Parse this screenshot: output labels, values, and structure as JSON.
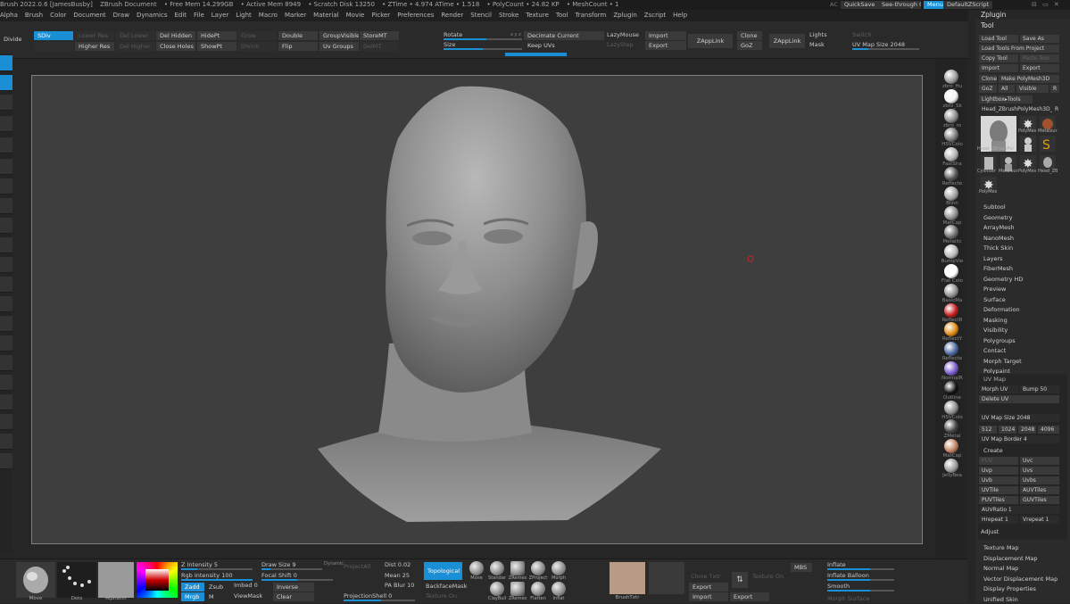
{
  "titlebar": {
    "app": "Brush 2022.0.6 [JamesBusby]",
    "doc": "ZBrush Document",
    "stats": [
      "• Free Mem 14.299GB",
      "• Active Mem 8949",
      "• Scratch Disk 13250",
      "• ZTime • 4.974 ATime • 1.518",
      "• PolyCount • 24.82 KP",
      "• MeshCount • 1"
    ],
    "ac": "AC",
    "quicksave": "QuickSave",
    "seethrough": "See-through  0",
    "menus": "Menus",
    "zscript": "DefaultZScript"
  },
  "menubar": [
    "Alpha",
    "Brush",
    "Color",
    "Document",
    "Draw",
    "Dynamics",
    "Edit",
    "File",
    "Layer",
    "Light",
    "Macro",
    "Marker",
    "Material",
    "Movie",
    "Picker",
    "Preferences",
    "Render",
    "Stencil",
    "Stroke",
    "Texture",
    "Tool",
    "Transform",
    "Zplugin",
    "Zscript",
    "Help"
  ],
  "topshelf": {
    "divide": "Divide",
    "smt": "SDiv",
    "lower_res": "Lower Res",
    "higher_res": "Higher Res",
    "del_lower": "Del Lower",
    "del_higher": "Del Higher",
    "del_hidden": "Del Hidden",
    "close_holes": "Close Holes",
    "hide_pt": "HidePt",
    "show_pt": "ShowPt",
    "grow": "Grow",
    "shrink": "Shrink",
    "double": "Double",
    "flip": "Flip",
    "group_visible": "GroupVisible",
    "uv_groups": "Uv Groups",
    "store_mt": "StoreMT",
    "del_mt": "DelMT",
    "rotate": "Rotate",
    "size": "Size",
    "decimate_current": "Decimate Current",
    "keep_uvs": "Keep UVs",
    "lazymouse": "LazyMouse",
    "lazystep": "LazyStep",
    "import": "Import",
    "export": "Export",
    "zapplink": "ZAppLink",
    "clone": "Clone",
    "goz": "GoZ",
    "zapplink2": "ZAppLink",
    "lights": "Lights",
    "mask": "Mask",
    "switch": "Switch",
    "uv_map_size": "UV Map Size 2048"
  },
  "rightshelf": {
    "materials": [
      {
        "name": "zbro_Hu",
        "color": "#9a9a9a"
      },
      {
        "name": "zbro_Sk",
        "color": "#f0f0f0"
      },
      {
        "name": "zbro_ro",
        "color": "#8a8a8a"
      },
      {
        "name": "HSVColo",
        "color": "#7a7a7a"
      },
      {
        "name": "FastSha",
        "color": "#b0b0b0"
      },
      {
        "name": "Reflecte",
        "color": "#555555"
      },
      {
        "name": "Blinn",
        "color": "#a0a0a0"
      },
      {
        "name": "MatCap",
        "color": "#8e8e8e"
      },
      {
        "name": "Metallic",
        "color": "#6e6e6e"
      },
      {
        "name": "BumpVie",
        "color": "#b8b8b8"
      },
      {
        "name": "Flat Colo",
        "color": "#ffffff"
      },
      {
        "name": "BasicMa",
        "color": "#909090"
      },
      {
        "name": "ReflectR",
        "color": "#c41c1c"
      },
      {
        "name": "ReflectY",
        "color": "#e08a10"
      },
      {
        "name": "Reflecte",
        "color": "#4a6aa0"
      },
      {
        "name": "NormalR",
        "color": "#7a5acc"
      },
      {
        "name": "Outline",
        "color": "#111111"
      },
      {
        "name": "HSVColo",
        "color": "#8c8c8c"
      },
      {
        "name": "ZMetal",
        "color": "#444444"
      },
      {
        "name": "MatCap",
        "color": "#c08060"
      },
      {
        "name": "JellyBea",
        "color": "#9a9a9a"
      }
    ]
  },
  "toolpanel": {
    "zplugin": "Zplugin",
    "tool": "Tool",
    "load_tool": "Load Tool",
    "save_as": "Save As",
    "load_from_project": "Load Tools From Project",
    "copy_tool": "Copy Tool",
    "paste_tool": "Paste Tool",
    "import": "Import",
    "export": "Export",
    "clone": "Clone",
    "make_polymesh": "Make PolyMesh3D",
    "goz": "GoZ",
    "all": "All",
    "visible": "Visible",
    "r": "R",
    "lightbox_tools": "Lightbox▸Tools",
    "current_tool": "Head_ZBrushPolyMesh3D_52",
    "current_tool_r": "R",
    "thumbs": [
      "Head_ZBrushPol",
      "PolyMes",
      "Metalsur",
      "Cylinder",
      "Metalsur",
      "PolyMes",
      "PolyMes",
      "Head_ZB",
      "PolyMes"
    ],
    "subpalettes": [
      "Subtool",
      "Geometry",
      "ArrayMesh",
      "NanoMesh",
      "Thick Skin",
      "Layers",
      "FiberMesh",
      "Geometry HD",
      "Preview",
      "Surface",
      "Deformation",
      "Masking",
      "Visibility",
      "Polygroups",
      "Contact",
      "Morph Target",
      "Polypaint"
    ],
    "uvmap": {
      "header": "UV Map",
      "morph_uv": "Morph UV",
      "bump": "Bump 50",
      "delete_uv": "Delete UV",
      "map_size": "UV Map Size 2048",
      "sizes": [
        "512",
        "1024",
        "2048",
        "4096"
      ],
      "border": "UV Map Border 4",
      "create": "Create",
      "btns": [
        "PUV",
        "Uvc",
        "Uvp",
        "Uvs",
        "Uvb",
        "Uvbs",
        "UVTile",
        "AUVTiles",
        "PUVTiles",
        "GUVTiles"
      ],
      "ratio": "AUVRatio 1",
      "hrepeat": "Hrepeat 1",
      "vrepeat": "Vrepeat 1",
      "adjust": "Adjust"
    },
    "lower": [
      "Texture Map",
      "Displacement Map",
      "Normal Map",
      "Vector Displacement Map",
      "Display Properties",
      "Unified Skin"
    ]
  },
  "bottom": {
    "move": "Move",
    "dots": "Dots",
    "alpha": "AlphaOff",
    "z_intensity": "Z Intensity 5",
    "rgb_intensity": "Rgb Intensity 100",
    "mrgb": "Mrgb",
    "rgb": "Rgb",
    "m": "M",
    "zadd": "Zadd",
    "zsub": "Zsub",
    "draw_size": "Draw Size 9",
    "dynamic": "Dynamic",
    "focal_shift": "Focal Shift 0",
    "imbed": "Imbed 0",
    "inverse": "Inverse",
    "viewmask": "ViewMask",
    "clear": "Clear",
    "project_all": "ProjectAll",
    "dist": "Dist 0.02",
    "mean": "Mean 25",
    "pa_blur": "PA Blur 10",
    "projection_shell": "ProjectionShell 0",
    "topological": "Topological",
    "backface_mask": "BackfaceMask",
    "texture_on": "Texture On",
    "brushes": [
      "Move",
      "Standar",
      "ZRemes",
      "ZProject",
      "Morph",
      "ClayBuil",
      "ZRemes",
      "Flatten",
      "Inflat"
    ],
    "brushtxt": "BrushTxtr",
    "clone_txt": "Clone Txtr",
    "export": "Export",
    "import": "Import",
    "export2": "Export",
    "texture_on2": "Texture On",
    "mbs": "MBS",
    "inflate": "Inflate",
    "inflate_balloon": "Inflate Balloon",
    "smooth": "Smooth",
    "morph": "Morph Surface"
  }
}
